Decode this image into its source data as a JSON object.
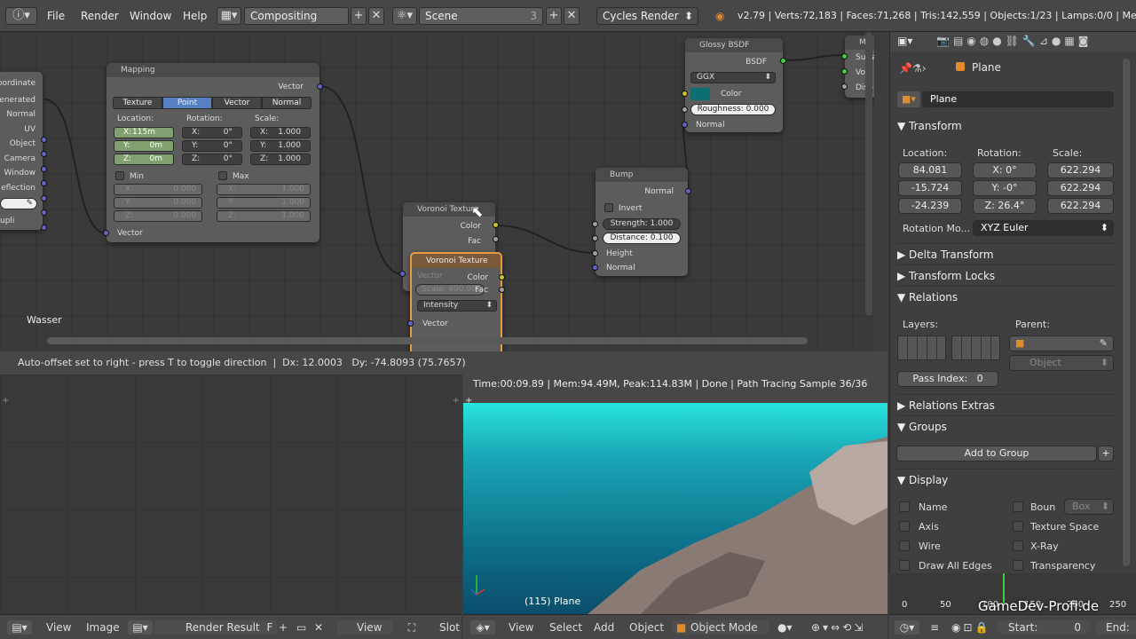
{
  "menu": {
    "file": "File",
    "render": "Render",
    "window": "Window",
    "help": "Help"
  },
  "screen_layout": "Compositing",
  "scene": {
    "name": "Scene",
    "users": "3"
  },
  "render_engine": "Cycles Render",
  "stats": "v2.79 | Verts:72,183 | Faces:71,268 | Tris:142,559 | Objects:1/23 | Lamps:0/0 | Mem:25",
  "node_editor": {
    "material_label": "Wasser",
    "texcoord": {
      "outputs": [
        "oordinate",
        "enerated",
        "Normal",
        "UV",
        "Object",
        "Camera",
        "Window",
        "eflection"
      ],
      "upli": "upli"
    },
    "mapping": {
      "title": "Mapping",
      "output": "Vector",
      "input": "Vector",
      "tabs": [
        "Texture",
        "Point",
        "Vector",
        "Normal"
      ],
      "location_label": "Location:",
      "rotation_label": "Rotation:",
      "scale_label": "Scale:",
      "loc": [
        "X:",
        "115m",
        "Y:",
        "0m",
        "Z:",
        "0m"
      ],
      "rot": [
        "X:",
        "0°",
        "Y:",
        "0°",
        "Z:",
        "0°"
      ],
      "scale": [
        "X:",
        "1.000",
        "Y:",
        "1.000",
        "Z:",
        "1.000"
      ],
      "min_label": "Min",
      "max_label": "Max",
      "min": [
        "X:",
        "0.000",
        "Y:",
        "0.000",
        "Z:",
        "0.000"
      ],
      "max": [
        "X:",
        "1.000",
        "Y:",
        "1.000",
        "Z:",
        "1.000"
      ]
    },
    "voronoi1": {
      "title": "Voronoi Texture",
      "out_color": "Color",
      "out_fac": "Fac"
    },
    "voronoi2": {
      "title": "Voronoi Texture",
      "vector": "Vector",
      "color": "Color",
      "scale": "Scale:",
      "scale_val": "400.000",
      "fac": "Fac",
      "mode": "Intensity",
      "input": "Vector"
    },
    "glossy": {
      "title": "Glossy BSDF",
      "output": "BSDF",
      "distribution": "GGX",
      "color": "Color",
      "roughness": "Roughness:",
      "roughness_val": "0.000",
      "normal": "Normal"
    },
    "bump": {
      "title": "Bump",
      "output": "Normal",
      "invert": "Invert",
      "strength": "Strength:",
      "strength_val": "1.000",
      "distance": "Distance:",
      "distance_val": "0.100",
      "height": "Height",
      "normal": "Normal"
    },
    "output": {
      "title": "Ma",
      "surface": "Surfa",
      "volume": "Volu",
      "displacement": "Disp"
    }
  },
  "status": "Auto-offset set to right - press T to toggle direction  |  Dx: 12.0003   Dy: -74.8093 (75.7657)",
  "render_info": "Time:00:09.89 | Mem:94.49M, Peak:114.83M | Done | Path Tracing Sample 36/36",
  "viewport_label": "(115) Plane",
  "bottom_left": {
    "view": "View",
    "image": "Image",
    "result": "Render Result",
    "f": "F",
    "view2": "View",
    "slot": "Slot"
  },
  "bottom_mid": {
    "view": "View",
    "select": "Select",
    "add": "Add",
    "object": "Object",
    "mode": "Object Mode"
  },
  "bottom_right": {
    "start_label": "Start:",
    "start_val": "0",
    "end_label": "End:"
  },
  "properties": {
    "breadcrumb": "Plane",
    "name": "Plane",
    "transform": "Transform",
    "location": "Location:",
    "rotation": "Rotation:",
    "scale": "Scale:",
    "loc": [
      "84.081",
      "-15.724",
      "-24.239"
    ],
    "rot": [
      [
        "X:",
        "0°"
      ],
      [
        "Y:",
        "-0°"
      ],
      [
        "Z:",
        "26.4°"
      ]
    ],
    "scl": [
      "622.294",
      "622.294",
      "622.294"
    ],
    "rotation_mode_label": "Rotation Mo...",
    "rotation_mode": "XYZ Euler",
    "delta": "Delta Transform",
    "locks": "Transform Locks",
    "relations": "Relations",
    "layers": "Layers:",
    "parent": "Parent:",
    "parent_type": "Object",
    "pass_index": "Pass Index:",
    "pass_val": "0",
    "relations_extras": "Relations Extras",
    "groups": "Groups",
    "add_group": "Add to Group",
    "display": "Display",
    "disp_left": [
      "Name",
      "Axis",
      "Wire",
      "Draw All Edges"
    ],
    "disp_right": [
      "Boun",
      "Texture Space",
      "X-Ray",
      "Transparency"
    ],
    "bounds_type": "Box"
  },
  "timeline": {
    "ticks": [
      "0",
      "50",
      "100",
      "150",
      "200",
      "250"
    ]
  },
  "watermark": "GameDev-Profi.de",
  "colors": {
    "selected_tab": "#5680c2",
    "water": "#1aa7b5",
    "active_node": "#e89a3c"
  }
}
